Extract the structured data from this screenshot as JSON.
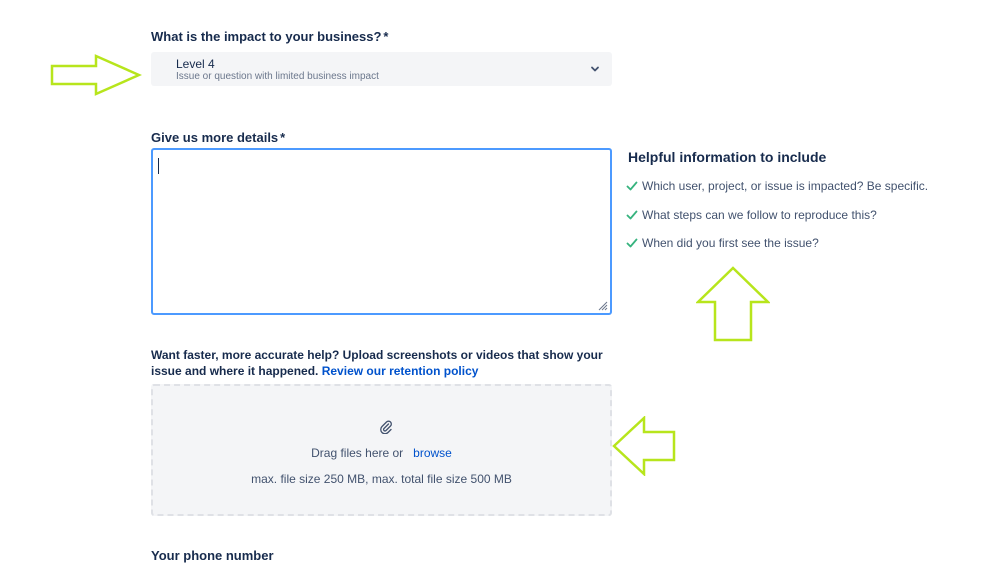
{
  "impact": {
    "label": "What is the impact to your business?",
    "required_mark": "*",
    "selected_value": "Level 4",
    "selected_description": "Issue or question with limited business impact"
  },
  "details": {
    "label": "Give us more details",
    "required_mark": "*",
    "value": ""
  },
  "helpful": {
    "title": "Helpful information to include",
    "items": [
      "Which user, project, or issue is impacted? Be specific.",
      "What steps can we follow to reproduce this?",
      "When did you first see the issue?"
    ]
  },
  "upload": {
    "prompt": "Want faster, more accurate help? Upload screenshots or videos that show your issue and where it happened.",
    "policy_link": "Review our retention policy",
    "drag_text": "Drag files here or",
    "browse_link": "browse",
    "limits": "max. file size 250 MB, max. total file size 500 MB"
  },
  "phone": {
    "label": "Your phone number"
  },
  "colors": {
    "annotation_arrow": "#b7e51c",
    "focus_border": "#4c9aff",
    "link": "#0052cc",
    "check": "#36b37e"
  }
}
